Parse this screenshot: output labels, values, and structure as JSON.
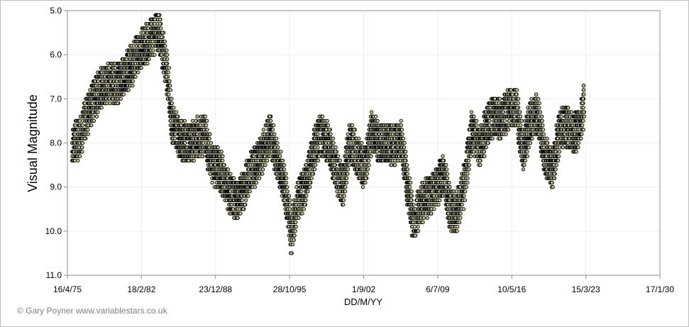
{
  "chart_data": {
    "type": "scatter",
    "xlabel": "DD/M/YY",
    "ylabel": "Visual Magnitude",
    "x_range": [
      "1975-04-16",
      "2030-01-17"
    ],
    "ylim": [
      5.0,
      11.0
    ],
    "y_reversed": true,
    "grid": true,
    "x_tick_labels": [
      "16/4/75",
      "18/2/82",
      "23/12/88",
      "28/10/95",
      "1/9/02",
      "6/7/09",
      "10/5/16",
      "15/3/23",
      "17/1/30"
    ],
    "y_tick_labels": [
      "5.0",
      "6.0",
      "7.0",
      "8.0",
      "9.0",
      "10.0",
      "11.0"
    ],
    "marker_fill": "#c8c88c",
    "marker_edge": "#000000",
    "trend": [
      [
        "1975-10-01",
        8.0
      ],
      [
        "1976-06-01",
        7.9
      ],
      [
        "1977-02-01",
        7.4
      ],
      [
        "1977-10-01",
        7.0
      ],
      [
        "1978-06-01",
        6.8
      ],
      [
        "1979-02-01",
        6.6
      ],
      [
        "1979-10-01",
        6.7
      ],
      [
        "1980-06-01",
        6.5
      ],
      [
        "1981-02-01",
        6.3
      ],
      [
        "1981-10-01",
        6.0
      ],
      [
        "1982-06-01",
        5.8
      ],
      [
        "1983-02-01",
        5.6
      ],
      [
        "1983-10-01",
        5.5
      ],
      [
        "1984-06-01",
        6.3
      ],
      [
        "1985-01-01",
        7.6
      ],
      [
        "1985-09-01",
        7.9
      ],
      [
        "1986-06-01",
        8.0
      ],
      [
        "1987-03-01",
        7.9
      ],
      [
        "1988-01-01",
        7.8
      ],
      [
        "1988-09-01",
        8.5
      ],
      [
        "1989-06-01",
        8.6
      ],
      [
        "1990-03-01",
        9.1
      ],
      [
        "1990-12-01",
        9.3
      ],
      [
        "1991-09-01",
        9.0
      ],
      [
        "1992-06-01",
        8.6
      ],
      [
        "1993-03-01",
        8.3
      ],
      [
        "1994-01-01",
        7.8
      ],
      [
        "1994-09-01",
        8.4
      ],
      [
        "1995-06-01",
        9.0
      ],
      [
        "1996-01-01",
        10.1
      ],
      [
        "1996-08-01",
        9.3
      ],
      [
        "1997-04-01",
        9.0
      ],
      [
        "1998-01-01",
        8.2
      ],
      [
        "1998-09-01",
        7.8
      ],
      [
        "1999-06-01",
        8.0
      ],
      [
        "2000-02-01",
        8.6
      ],
      [
        "2000-10-01",
        9.0
      ],
      [
        "2001-06-01",
        7.9
      ],
      [
        "2002-02-01",
        8.3
      ],
      [
        "2002-10-01",
        8.6
      ],
      [
        "2003-06-01",
        7.7
      ],
      [
        "2004-02-01",
        8.0
      ],
      [
        "2004-10-01",
        8.0
      ],
      [
        "2005-06-01",
        8.1
      ],
      [
        "2006-02-01",
        7.9
      ],
      [
        "2006-10-01",
        9.0
      ],
      [
        "2007-04-01",
        9.8
      ],
      [
        "2008-01-01",
        9.4
      ],
      [
        "2008-10-01",
        9.2
      ],
      [
        "2009-06-01",
        9.0
      ],
      [
        "2010-02-01",
        8.7
      ],
      [
        "2010-09-01",
        9.5
      ],
      [
        "2011-04-01",
        9.6
      ],
      [
        "2012-01-01",
        8.9
      ],
      [
        "2012-09-01",
        7.7
      ],
      [
        "2013-06-01",
        8.1
      ],
      [
        "2014-02-01",
        7.6
      ],
      [
        "2014-10-01",
        7.4
      ],
      [
        "2015-06-01",
        7.5
      ],
      [
        "2016-02-01",
        7.2
      ],
      [
        "2016-10-01",
        7.2
      ],
      [
        "2017-06-01",
        8.2
      ],
      [
        "2018-02-01",
        7.5
      ],
      [
        "2018-10-01",
        7.3
      ],
      [
        "2019-06-01",
        8.3
      ],
      [
        "2020-03-01",
        8.6
      ],
      [
        "2020-10-01",
        7.7
      ],
      [
        "2021-06-01",
        7.6
      ],
      [
        "2022-03-01",
        7.8
      ],
      [
        "2022-10-01",
        7.6
      ],
      [
        "2023-01-01",
        7.1
      ]
    ],
    "spread": 0.45
  },
  "credit": "© Gary Poyner www.variablestars.co.uk"
}
